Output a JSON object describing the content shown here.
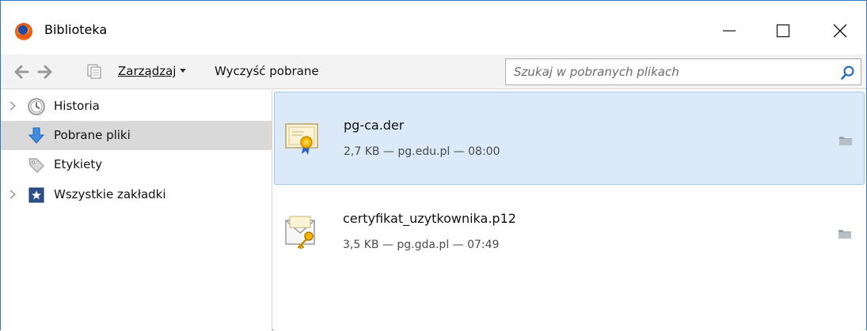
{
  "window": {
    "title": "Biblioteka"
  },
  "toolbar": {
    "organize_label": "Zarządzaj",
    "clear_label": "Wyczyść pobrane",
    "search_placeholder": "Szukaj w pobranych plikach"
  },
  "sidebar": {
    "items": [
      {
        "label": "Historia",
        "icon": "clock-icon",
        "expandable": true,
        "selected": false
      },
      {
        "label": "Pobrane pliki",
        "icon": "download-arrow-icon",
        "expandable": false,
        "selected": true
      },
      {
        "label": "Etykiety",
        "icon": "tag-icon",
        "expandable": false,
        "selected": false
      },
      {
        "label": "Wszystkie zakładki",
        "icon": "star-bookmark-icon",
        "expandable": true,
        "selected": false
      }
    ]
  },
  "downloads": {
    "items": [
      {
        "name": "pg-ca.der",
        "meta": "2,7 KB — pg.edu.pl — 08:00",
        "icon": "certificate-icon",
        "selected": true
      },
      {
        "name": "certyfikat_uzytkownika.p12",
        "meta": "3,5 KB — pg.gda.pl — 07:49",
        "icon": "key-envelope-icon",
        "selected": false
      }
    ]
  },
  "colors": {
    "accent_border": "#2b78c6",
    "selection_bg": "#dce9f9",
    "sidebar_selected": "#d9d9d9",
    "toolbar_bg": "#f3f3f3"
  }
}
